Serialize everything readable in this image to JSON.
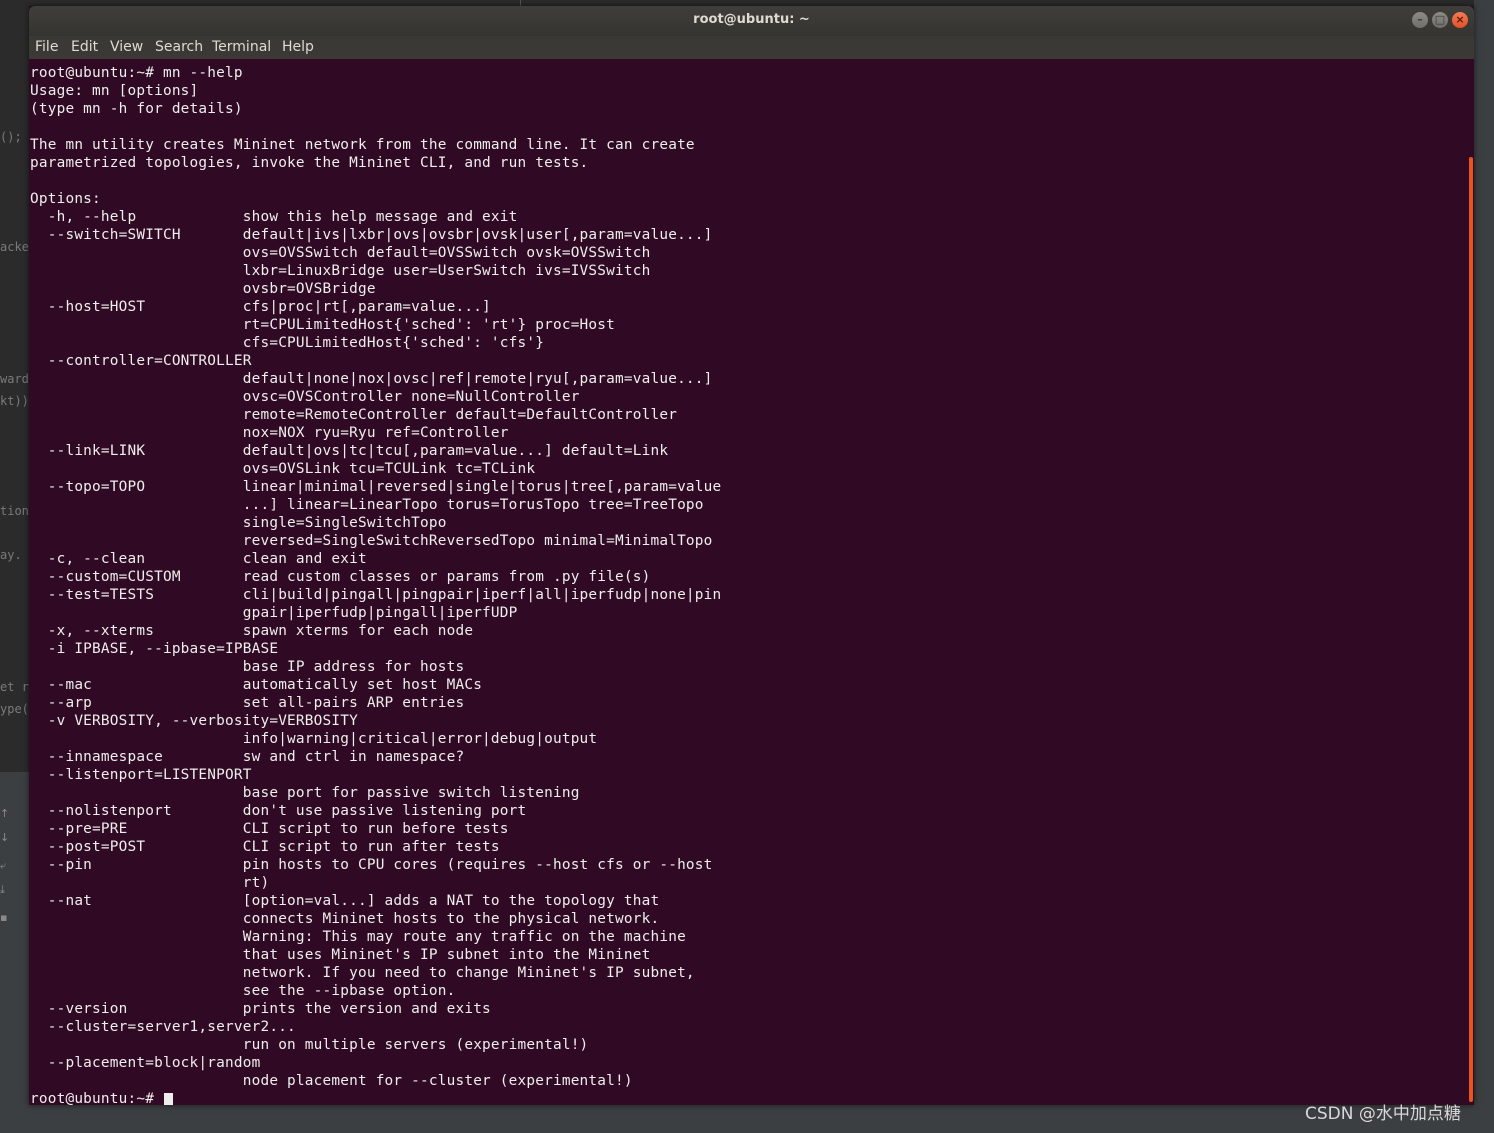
{
  "window": {
    "title": "root@ubuntu: ~",
    "minimize_icon": "minimize-icon",
    "maximize_icon": "maximize-icon",
    "close_icon": "close-icon",
    "colors": {
      "terminal_bg": "#300a24",
      "text": "#eeeeec",
      "scrollbar": "#e95420"
    }
  },
  "menu": [
    "File",
    "Edit",
    "View",
    "Search",
    "Terminal",
    "Help"
  ],
  "background_fragments": [
    "();",
    "acke",
    "ward",
    "kt))",
    "tion",
    "ay.",
    "et r",
    "ype("
  ],
  "terminal": {
    "lines": [
      "root@ubuntu:~# mn --help",
      "Usage: mn [options]",
      "(type mn -h for details)",
      "",
      "The mn utility creates Mininet network from the command line. It can create",
      "parametrized topologies, invoke the Mininet CLI, and run tests.",
      "",
      "Options:",
      "  -h, --help            show this help message and exit",
      "  --switch=SWITCH       default|ivs|lxbr|ovs|ovsbr|ovsk|user[,param=value...]",
      "                        ovs=OVSSwitch default=OVSSwitch ovsk=OVSSwitch",
      "                        lxbr=LinuxBridge user=UserSwitch ivs=IVSSwitch",
      "                        ovsbr=OVSBridge",
      "  --host=HOST           cfs|proc|rt[,param=value...]",
      "                        rt=CPULimitedHost{'sched': 'rt'} proc=Host",
      "                        cfs=CPULimitedHost{'sched': 'cfs'}",
      "  --controller=CONTROLLER",
      "                        default|none|nox|ovsc|ref|remote|ryu[,param=value...]",
      "                        ovsc=OVSController none=NullController",
      "                        remote=RemoteController default=DefaultController",
      "                        nox=NOX ryu=Ryu ref=Controller",
      "  --link=LINK           default|ovs|tc|tcu[,param=value...] default=Link",
      "                        ovs=OVSLink tcu=TCULink tc=TCLink",
      "  --topo=TOPO           linear|minimal|reversed|single|torus|tree[,param=value",
      "                        ...] linear=LinearTopo torus=TorusTopo tree=TreeTopo",
      "                        single=SingleSwitchTopo",
      "                        reversed=SingleSwitchReversedTopo minimal=MinimalTopo",
      "  -c, --clean           clean and exit",
      "  --custom=CUSTOM       read custom classes or params from .py file(s)",
      "  --test=TESTS          cli|build|pingall|pingpair|iperf|all|iperfudp|none|pin",
      "                        gpair|iperfudp|pingall|iperfUDP",
      "  -x, --xterms          spawn xterms for each node",
      "  -i IPBASE, --ipbase=IPBASE",
      "                        base IP address for hosts",
      "  --mac                 automatically set host MACs",
      "  --arp                 set all-pairs ARP entries",
      "  -v VERBOSITY, --verbosity=VERBOSITY",
      "                        info|warning|critical|error|debug|output",
      "  --innamespace         sw and ctrl in namespace?",
      "  --listenport=LISTENPORT",
      "                        base port for passive switch listening",
      "  --nolistenport        don't use passive listening port",
      "  --pre=PRE             CLI script to run before tests",
      "  --post=POST           CLI script to run after tests",
      "  --pin                 pin hosts to CPU cores (requires --host cfs or --host",
      "                        rt)",
      "  --nat                 [option=val...] adds a NAT to the topology that",
      "                        connects Mininet hosts to the physical network.",
      "                        Warning: This may route any traffic on the machine",
      "                        that uses Mininet's IP subnet into the Mininet",
      "                        network. If you need to change Mininet's IP subnet,",
      "                        see the --ipbase option.",
      "  --version             prints the version and exits",
      "  --cluster=server1,server2...",
      "                        run on multiple servers (experimental!)",
      "  --placement=block|random",
      "                        node placement for --cluster (experimental!)",
      "root@ubuntu:~# "
    ]
  },
  "watermark": "CSDN @水中加点糖"
}
